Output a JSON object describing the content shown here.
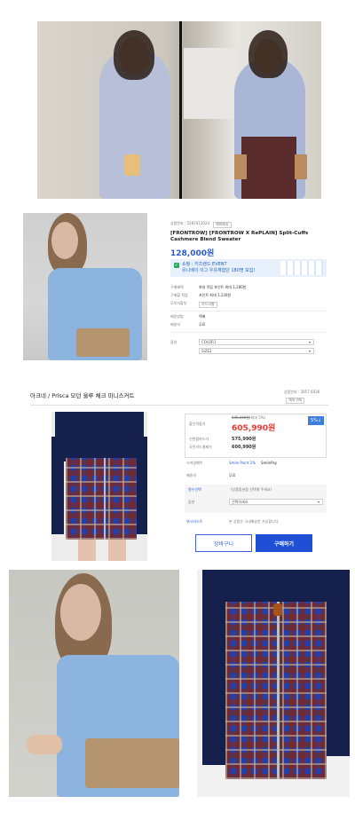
{
  "colors": {
    "price_blue": "#2a5bd7",
    "price_red": "#e53935",
    "cart_border": "#3b62d9",
    "buy_blue": "#1e4fd6",
    "event_bg": "#e8f1fb",
    "badge_blue": "#3c7de0"
  },
  "p1": {
    "product_code": "상품번호 : 5287412024",
    "badge": "해외배송",
    "title": "[FRONTROW] [FRONTROW X RePLAIN] Split-Cuffs Cashmere Blend Sweater",
    "price": "128,000원",
    "event_title": "쇼핑 : 키즈랜드 EVENT",
    "event_sub": "유니베이 이그 우유체험단 180명 모집!",
    "rows": [
      {
        "label": "구매혜택",
        "value": "최대 적립 포인트 최대 1,280원"
      },
      {
        "label": "구매할 적립",
        "value": "포인트 최대 1,130원"
      },
      {
        "label": "무이자할부",
        "value": "카드사별"
      },
      {
        "label": "배송방법",
        "value": "택배"
      },
      {
        "label": "배송비",
        "value": "무료"
      }
    ],
    "option_label": "옵션",
    "select1": "COLOR1",
    "select2": "SIZE2"
  },
  "p2": {
    "title": "아크네 / Prisca 모던 울루 체크 미니스커트",
    "product_code": "상품번호 : 2857 6036",
    "code_badge": "해외구매",
    "price_label": "할인적용가",
    "orig_price": "645,000원",
    "discount": "(최대 5%)",
    "price": "605,990원",
    "rate_badge": "5%↓",
    "card_rows": [
      {
        "label": "신한앱카드가",
        "value": "575,990원"
      },
      {
        "label": "국민카드결제가",
        "value": "600,990원"
      }
    ],
    "point_label": "스마일페이",
    "smile_point": "Smile Point  1%",
    "smile_pay": "SmilePay",
    "ship_label": "배송비",
    "ship_value": "무료",
    "choice_label": "필수선택",
    "choice_text": "(상품옵션을 선택해 주세요)",
    "option_label": "옵션",
    "select_placeholder": "선택하세요",
    "notice": "본 상품은 국내배송만 가능합니다.",
    "wish_label": "위시리스트",
    "cart_label": "장바구니",
    "buy_label": "구매하기"
  },
  "icons": [
    "check-icon",
    "chevron-down-icon",
    "heart-icon",
    "info-icon"
  ]
}
